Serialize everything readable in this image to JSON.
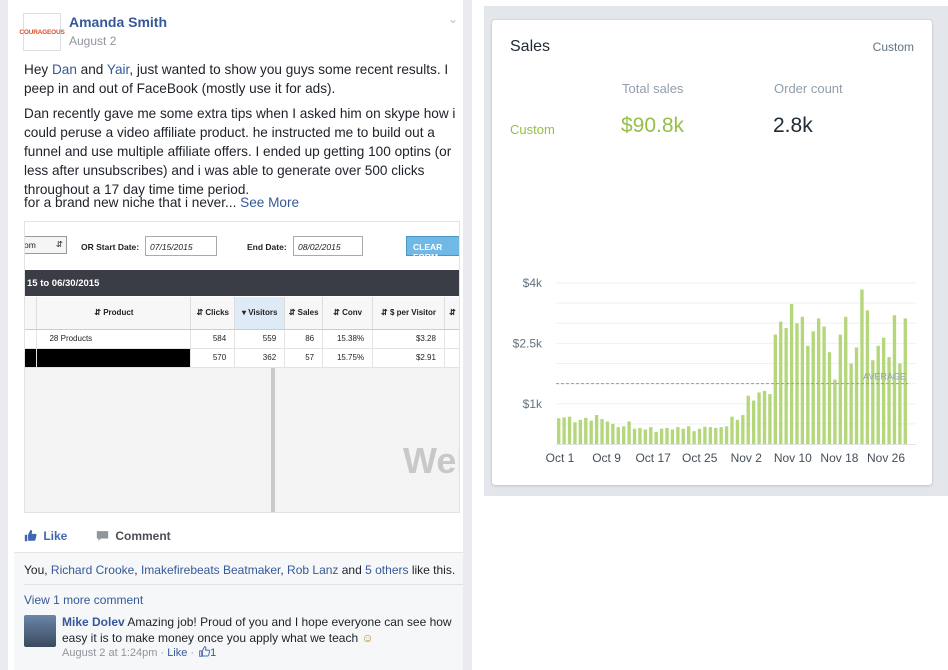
{
  "post": {
    "author": "Amanda Smith",
    "date": "August 2",
    "avatar_text": "COURAGEOUS",
    "p1": {
      "before": "Hey ",
      "name1": "Dan",
      "mid": " and ",
      "name2": "Yair",
      "after": ", just wanted to show you guys some recent results. I peep in and out of FaceBook (mostly use it for ads)."
    },
    "p2": "Dan recently gave me some extra tips when I asked him on skype how i could peruse a video affiliate product. he instructed me to build out a funnel and use multiple affiliate offers. I ended up getting 100 optins (or less after unsubscribes) and i was able to generate over 500 clicks throughout a 17 day time time period.",
    "p3": {
      "text": "for a brand new niche that i never...",
      "see_more": "See More"
    },
    "actions": {
      "like": "Like",
      "comment": "Comment"
    },
    "likes": {
      "you": "You, ",
      "n1": "Richard Crooke",
      "sep": ", ",
      "n2": "Imakefirebeats Beatmaker",
      "sep2": ", ",
      "n3": "Rob Lanz",
      "and": " and ",
      "others": "5 others",
      "suffix": " like this."
    },
    "view_more": "View 1 more comment",
    "comment": {
      "author": "Mike Dolev",
      "text": " Amazing job! Proud of you and I hope everyone can see how easy it is to make money once you apply what we teach ",
      "emoji": "☺",
      "meta_date": "August 2 at 1:24pm",
      "meta_dot": " · ",
      "meta_like": "Like",
      "meta_dot2": " · ",
      "meta_count": "1"
    }
  },
  "report": {
    "select_value": "om",
    "or_label": "OR  Start Date:",
    "start_date": "07/15/2015",
    "end_label": "End Date:",
    "end_date": "08/02/2015",
    "clear_label": "CLEAR FORM",
    "band": "15 to 06/30/2015",
    "headers": [
      "",
      "Product",
      "Clicks",
      "Visitors",
      "Sales",
      "Conv",
      "$ per Visitor",
      ""
    ],
    "rows": [
      [
        "",
        "28 Products",
        "584",
        "559",
        "86",
        "15.38%",
        "$3.28",
        ""
      ],
      [
        "",
        "",
        "570",
        "362",
        "57",
        "15.75%",
        "$2.91",
        ""
      ]
    ],
    "watermark": "Wel"
  },
  "sales": {
    "title": "Sales",
    "range": "Custom",
    "row_label": "Custom",
    "total_label": "Total sales",
    "total_value": "$90.8k",
    "order_label": "Order count",
    "order_value": "2.8k",
    "accent": "#96bf48",
    "chart_data": {
      "type": "bar",
      "yticks": [
        "$4k",
        "$2.5k",
        "$1k"
      ],
      "ytick_values": [
        4000,
        2500,
        1000
      ],
      "xticks": [
        "Oct 1",
        "Oct 9",
        "Oct 17",
        "Oct 25",
        "Nov 2",
        "Nov 10",
        "Nov 18",
        "Nov 26"
      ],
      "ylim": [
        0,
        4000
      ],
      "average_label": "AVERAGE",
      "average": 1500,
      "color": "#b5d77c",
      "values": [
        640,
        660,
        680,
        540,
        600,
        650,
        580,
        720,
        620,
        560,
        500,
        420,
        440,
        560,
        380,
        400,
        360,
        420,
        300,
        380,
        400,
        360,
        420,
        380,
        440,
        320,
        380,
        430,
        420,
        400,
        420,
        440,
        680,
        600,
        720,
        1200,
        1080,
        1280,
        1320,
        1240,
        2720,
        3040,
        2880,
        3480,
        3000,
        3160,
        2440,
        2800,
        3120,
        2920,
        2280,
        1600,
        2720,
        3160,
        2000,
        2400,
        3840,
        3320,
        2080,
        2440,
        2640,
        2160,
        3200,
        2000,
        3120
      ]
    }
  }
}
